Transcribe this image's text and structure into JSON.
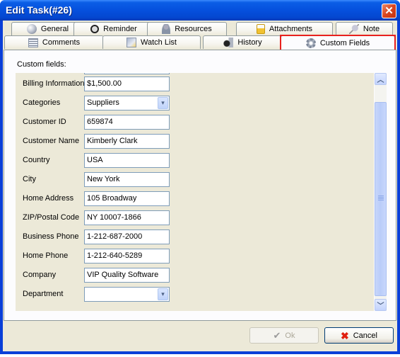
{
  "window": {
    "title": "Edit Task(#26)",
    "close_icon": "close-icon"
  },
  "tabs": {
    "row1": [
      {
        "label": "General",
        "icon": "sphere-icon"
      },
      {
        "label": "Reminder",
        "icon": "alarm-clock-icon"
      },
      {
        "label": "Resources",
        "icon": "person-icon"
      },
      {
        "label": "Attachments",
        "icon": "paperclip-folder-icon"
      },
      {
        "label": "Note",
        "icon": "pushpin-icon"
      }
    ],
    "row2": [
      {
        "label": "Comments",
        "icon": "comments-icon"
      },
      {
        "label": "Watch List",
        "icon": "watch-list-icon"
      },
      {
        "label": "History",
        "icon": "history-icon"
      },
      {
        "label": "Custom Fields",
        "icon": "gear-icon",
        "active": true
      }
    ]
  },
  "pane": {
    "label": "Custom fields:",
    "fields": [
      {
        "label": "Billing Information",
        "value": "$1,500.00",
        "type": "text"
      },
      {
        "label": "Categories",
        "value": "Suppliers",
        "type": "combo"
      },
      {
        "label": "Customer ID",
        "value": "659874",
        "type": "text"
      },
      {
        "label": "Customer Name",
        "value": "Kimberly Clark",
        "type": "text"
      },
      {
        "label": "Country",
        "value": "USA",
        "type": "text"
      },
      {
        "label": "City",
        "value": "New York",
        "type": "text"
      },
      {
        "label": "Home Address",
        "value": "105 Broadway",
        "type": "text"
      },
      {
        "label": "ZIP/Postal Code",
        "value": "NY 10007-1866",
        "type": "text"
      },
      {
        "label": "Business Phone",
        "value": "1-212-687-2000",
        "type": "text"
      },
      {
        "label": "Home Phone",
        "value": "1-212-640-5289",
        "type": "text"
      },
      {
        "label": "Company",
        "value": "VIP Quality Software",
        "type": "text"
      },
      {
        "label": "Department",
        "value": "",
        "type": "combo"
      }
    ]
  },
  "buttons": {
    "ok": "Ok",
    "cancel": "Cancel"
  },
  "colors": {
    "highlight": "#e8211e",
    "titlebar": "#0550dd",
    "face": "#ece9d8"
  }
}
